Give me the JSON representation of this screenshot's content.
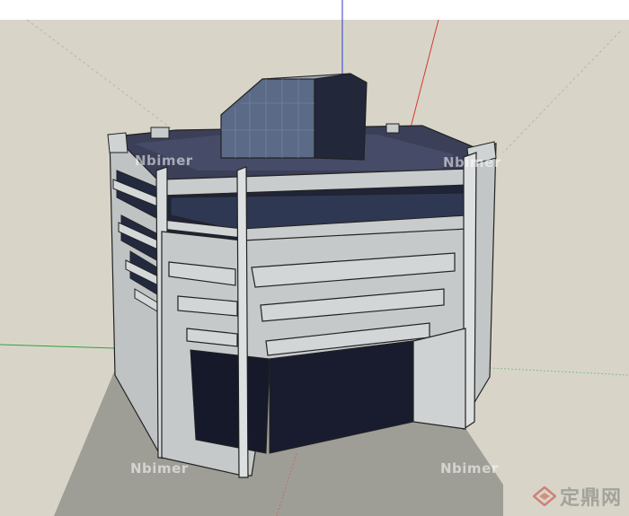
{
  "viewport": {
    "name": "SketchUp 3D model viewport",
    "sky_color": "#ffffff",
    "ground_color": "#d8d5c8",
    "shadow_color": "#9e9e97",
    "axis_colors": {
      "red": "#d23a2e",
      "green": "#2ea33c",
      "blue": "#2b3bd0"
    }
  },
  "model": {
    "wall_color": "#c9cccc",
    "wall_shade_color": "#aeb3b3",
    "glass_color": "#1e2236",
    "glass_blue_color": "#2d3552",
    "roof_color": "#3b3f58",
    "penthouse_color": "#3a4460"
  },
  "watermarks": {
    "repeat_text": "Nbimer",
    "logo_text": "定鼎网"
  }
}
